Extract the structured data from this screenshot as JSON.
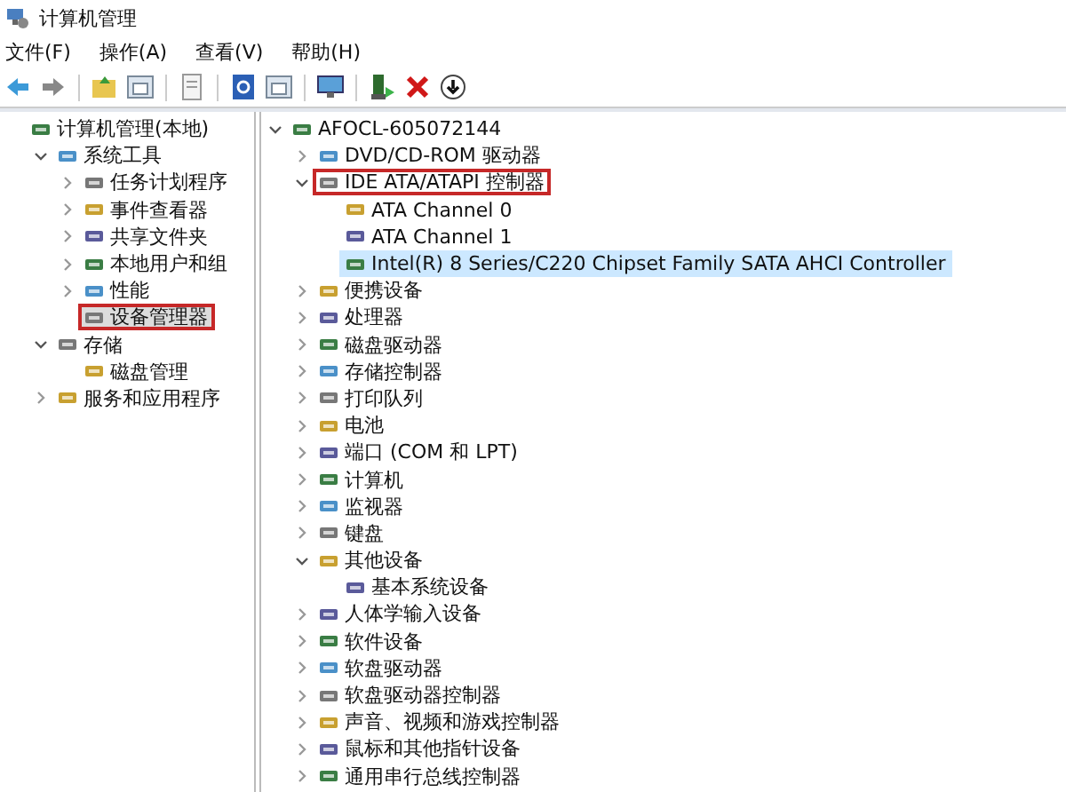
{
  "window": {
    "title": "计算机管理"
  },
  "menu": [
    "文件(F)",
    "操作(A)",
    "查看(V)",
    "帮助(H)"
  ],
  "left_tree": [
    {
      "label": "计算机管理(本地)",
      "selected": false,
      "highlighted": false,
      "children": [
        {
          "label": "系统工具",
          "expanded": true,
          "selected": false,
          "highlighted": false,
          "children": [
            {
              "label": "任务计划程序",
              "expanded": false,
              "selected": false,
              "highlighted": false
            },
            {
              "label": "事件查看器",
              "expanded": false,
              "selected": false,
              "highlighted": false
            },
            {
              "label": "共享文件夹",
              "expanded": false,
              "selected": false,
              "highlighted": false
            },
            {
              "label": "本地用户和组",
              "expanded": false,
              "selected": false,
              "highlighted": false
            },
            {
              "label": "性能",
              "expanded": false,
              "selected": false,
              "highlighted": false
            },
            {
              "label": "设备管理器",
              "selected": true,
              "highlighted": true
            }
          ]
        },
        {
          "label": "存储",
          "expanded": true,
          "selected": false,
          "highlighted": false,
          "children": [
            {
              "label": "磁盘管理",
              "selected": false,
              "highlighted": false
            }
          ]
        },
        {
          "label": "服务和应用程序",
          "expanded": false,
          "selected": false,
          "highlighted": false
        }
      ]
    }
  ],
  "device_tree": [
    {
      "label": "AFOCL-605072144",
      "expanded": true,
      "selected": false,
      "highlighted": false,
      "children": [
        {
          "label": "DVD/CD-ROM 驱动器",
          "expanded": false,
          "selected": false,
          "highlighted": false
        },
        {
          "label": "IDE ATA/ATAPI 控制器",
          "expanded": true,
          "selected": false,
          "highlighted": true,
          "children": [
            {
              "label": "ATA Channel 0",
              "selected": false,
              "highlighted": false
            },
            {
              "label": "ATA Channel 1",
              "selected": false,
              "highlighted": false
            },
            {
              "label": "Intel(R) 8 Series/C220 Chipset Family SATA AHCI Controller",
              "selected": true,
              "highlighted": false
            }
          ]
        },
        {
          "label": "便携设备",
          "expanded": false,
          "selected": false,
          "highlighted": false
        },
        {
          "label": "处理器",
          "expanded": false,
          "selected": false,
          "highlighted": false
        },
        {
          "label": "磁盘驱动器",
          "expanded": false,
          "selected": false,
          "highlighted": false
        },
        {
          "label": "存储控制器",
          "expanded": false,
          "selected": false,
          "highlighted": false
        },
        {
          "label": "打印队列",
          "expanded": false,
          "selected": false,
          "highlighted": false
        },
        {
          "label": "电池",
          "expanded": false,
          "selected": false,
          "highlighted": false
        },
        {
          "label": "端口 (COM 和 LPT)",
          "expanded": false,
          "selected": false,
          "highlighted": false
        },
        {
          "label": "计算机",
          "expanded": false,
          "selected": false,
          "highlighted": false
        },
        {
          "label": "监视器",
          "expanded": false,
          "selected": false,
          "highlighted": false
        },
        {
          "label": "键盘",
          "expanded": false,
          "selected": false,
          "highlighted": false
        },
        {
          "label": "其他设备",
          "expanded": true,
          "selected": false,
          "highlighted": false,
          "children": [
            {
              "label": "基本系统设备",
              "selected": false,
              "highlighted": false
            }
          ]
        },
        {
          "label": "人体学输入设备",
          "expanded": false,
          "selected": false,
          "highlighted": false
        },
        {
          "label": "软件设备",
          "expanded": false,
          "selected": false,
          "highlighted": false
        },
        {
          "label": "软盘驱动器",
          "expanded": false,
          "selected": false,
          "highlighted": false
        },
        {
          "label": "软盘驱动器控制器",
          "expanded": false,
          "selected": false,
          "highlighted": false
        },
        {
          "label": "声音、视频和游戏控制器",
          "expanded": false,
          "selected": false,
          "highlighted": false
        },
        {
          "label": "鼠标和其他指针设备",
          "expanded": false,
          "selected": false,
          "highlighted": false
        },
        {
          "label": "通用串行总线控制器",
          "expanded": false,
          "selected": false,
          "highlighted": false
        }
      ]
    }
  ]
}
